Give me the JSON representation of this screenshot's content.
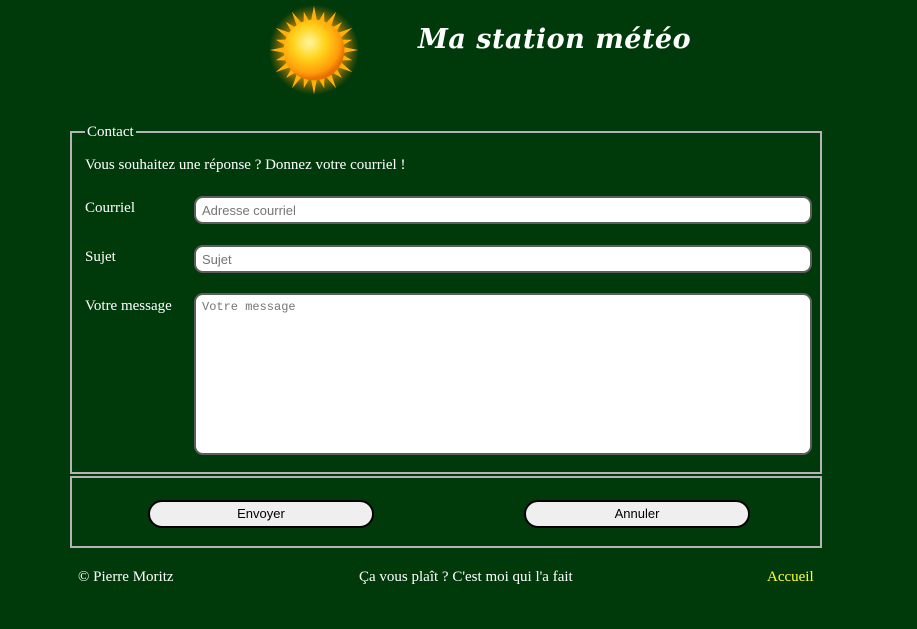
{
  "header": {
    "title": "Ma station météo",
    "logo_icon": "sun-icon"
  },
  "contact": {
    "legend": "Contact",
    "intro": "Vous souhaitez une réponse ? Donnez votre courriel !",
    "email": {
      "label": "Courriel",
      "placeholder": "Adresse courriel",
      "value": ""
    },
    "subject": {
      "label": "Sujet",
      "placeholder": "Sujet",
      "value": ""
    },
    "message": {
      "label": "Votre message",
      "placeholder": "Votre message",
      "value": ""
    }
  },
  "actions": {
    "submit_label": "Envoyer",
    "cancel_label": "Annuler"
  },
  "footer": {
    "copyright": "© Pierre Moritz",
    "tagline": "Ça vous plaît ? C'est moi qui l'a fait",
    "home_link": "Accueil"
  },
  "colors": {
    "background": "#003a0a",
    "link": "#ffff33",
    "border": "#b4b4b4"
  }
}
